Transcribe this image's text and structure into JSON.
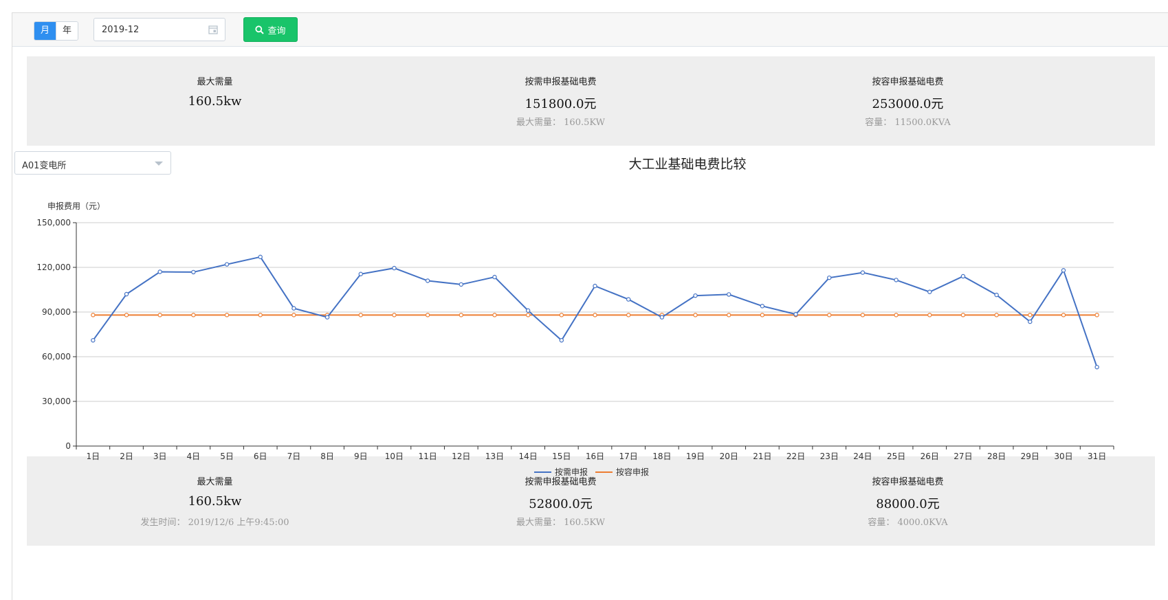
{
  "toolbar": {
    "period_month_label": "月",
    "period_year_label": "年",
    "date_value": "2019-12",
    "query_label": "查询",
    "colors": {
      "accent": "#2f8ff0",
      "query": "#19c46a"
    }
  },
  "top_stats": [
    {
      "label": "最大需量",
      "value": "160.5kw",
      "sub": ""
    },
    {
      "label": "按需申报基础电费",
      "value": "151800.0元",
      "sub": "最大需量：  160.5KW"
    },
    {
      "label": "按容申报基础电费",
      "value": "253000.0元",
      "sub": "容量：  11500.0KVA"
    }
  ],
  "station_select": {
    "value": "A01变电所"
  },
  "bottom_stats": [
    {
      "label": "最大需量",
      "value": "160.5kw",
      "sub": "发生时间：  2019/12/6 上午9:45:00"
    },
    {
      "label": "按需申报基础电费",
      "value": "52800.0元",
      "sub": "最大需量：  160.5KW"
    },
    {
      "label": "按容申报基础电费",
      "value": "88000.0元",
      "sub": "容量：  4000.0KVA"
    }
  ],
  "chart_data": {
    "type": "line",
    "title": "大工业基础电费比较",
    "ylabel": "申报费用（元）",
    "xlabel": "",
    "ylim": [
      0,
      150000
    ],
    "y_ticks": [
      "0",
      "30,000",
      "60,000",
      "90,000",
      "120,000",
      "150,000"
    ],
    "y_tick_values": [
      0,
      30000,
      60000,
      90000,
      120000,
      150000
    ],
    "grid": true,
    "legend_position": "bottom-center",
    "categories": [
      "1日",
      "2日",
      "3日",
      "4日",
      "5日",
      "6日",
      "7日",
      "8日",
      "9日",
      "10日",
      "11日",
      "12日",
      "13日",
      "14日",
      "15日",
      "16日",
      "17日",
      "18日",
      "19日",
      "20日",
      "21日",
      "22日",
      "23日",
      "24日",
      "25日",
      "26日",
      "27日",
      "28日",
      "29日",
      "30日",
      "31日"
    ],
    "series": [
      {
        "name": "按需申报",
        "color": "#4472c4",
        "values": [
          71000,
          102000,
          117000,
          116800,
          122000,
          127000,
          92500,
          86500,
          115500,
          119500,
          111000,
          108500,
          113500,
          91000,
          71000,
          107500,
          98500,
          86500,
          101000,
          101800,
          94000,
          88500,
          113000,
          116500,
          111500,
          103500,
          114000,
          101500,
          83500,
          118000,
          53000
        ]
      },
      {
        "name": "按容申报",
        "color": "#ed7d31",
        "values": [
          88000,
          88000,
          88000,
          88000,
          88000,
          88000,
          88000,
          88000,
          88000,
          88000,
          88000,
          88000,
          88000,
          88000,
          88000,
          88000,
          88000,
          88000,
          88000,
          88000,
          88000,
          88000,
          88000,
          88000,
          88000,
          88000,
          88000,
          88000,
          88000,
          88000,
          88000
        ]
      }
    ]
  }
}
